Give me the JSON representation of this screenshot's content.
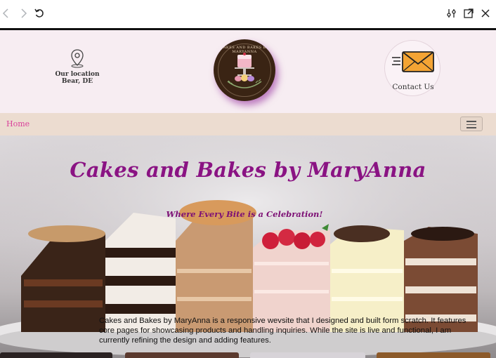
{
  "browser": {
    "back_icon": "chevron-left-icon",
    "forward_icon": "chevron-right-icon",
    "reload_icon": "undo-icon",
    "tools_icon": "sliders-icon",
    "popout_icon": "external-link-icon",
    "close_icon": "close-icon"
  },
  "header": {
    "location_line1": "Our location",
    "location_line2": "Bear, DE",
    "logo_arc_text": "CAKES AND BAKES BY MARYANNA",
    "contact_label": "Contact Us",
    "background_color": "#f7edf2",
    "accent_color": "#8a1383"
  },
  "navbar": {
    "home_label": "Home",
    "home_color": "#d9409a",
    "toggle_icon": "hamburger-icon"
  },
  "hero": {
    "title": "Cakes and Bakes by MaryAnna",
    "subtitle": "Where Every Bite is a Celebration!",
    "description": "Cakes and Bakes by MaryAnna is a responsive wevsite that  I designed and built form scratch. It features core pages for showcasing products and handling inquiries. While the site is live and functional, I am currently refining the design and adding features."
  }
}
